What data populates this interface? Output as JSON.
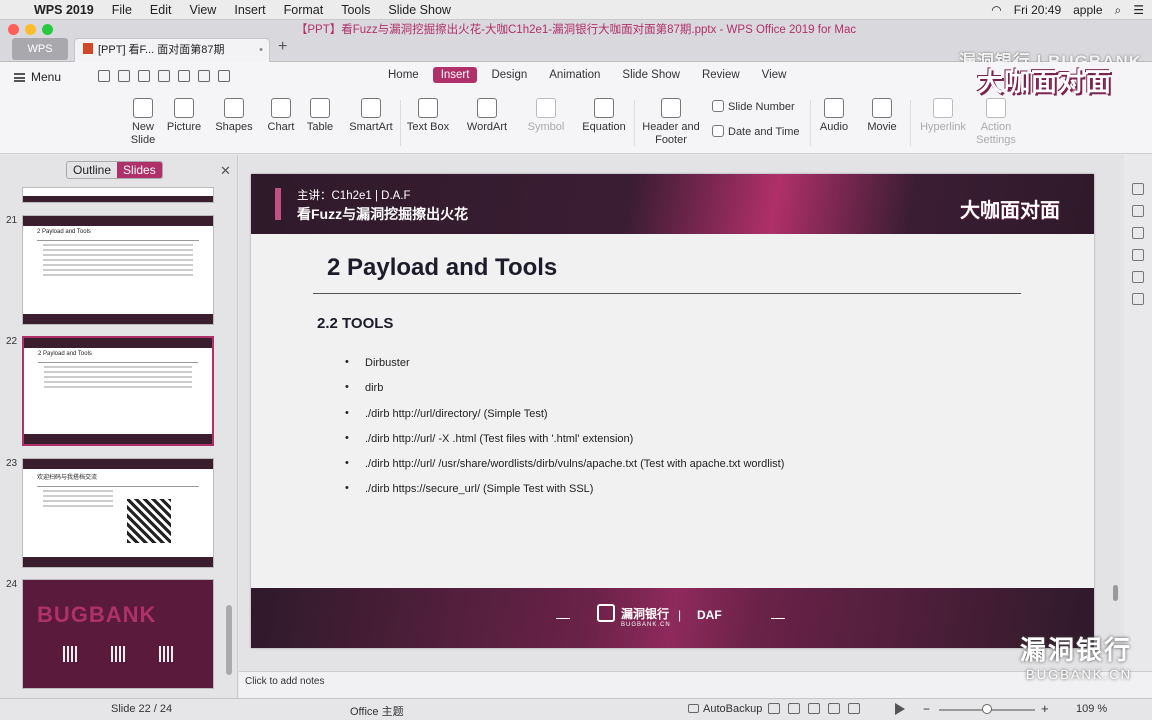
{
  "menubar": {
    "app": "WPS 2019",
    "items": [
      "File",
      "Edit",
      "View",
      "Insert",
      "Format",
      "Tools",
      "Slide Show"
    ],
    "clock": "Fri 20:49",
    "user": "apple"
  },
  "window": {
    "title": "【PPT】看Fuzz与漏洞挖掘擦出火花-大咖C1h2e1-漏洞银行大咖面对面第87期.pptx - WPS Office 2019 for Mac",
    "wps_tab": "WPS",
    "doc_tab": "[PPT] 看F... 面对面第87期",
    "watermark": "漏洞银行 | BUGBANK"
  },
  "ribbon": {
    "menu_label": "Menu",
    "tabs": [
      "Home",
      "Insert",
      "Design",
      "Animation",
      "Slide Show",
      "Review",
      "View"
    ],
    "active_tab": "Insert",
    "logo": "大咖面对面",
    "tools": {
      "new_slide": "New Slide",
      "picture": "Picture",
      "shapes": "Shapes",
      "chart": "Chart",
      "table": "Table",
      "smartart": "SmartArt",
      "text_box": "Text Box",
      "wordart": "WordArt",
      "symbol": "Symbol",
      "equation": "Equation",
      "header_footer": "Header and Footer",
      "slide_number": "Slide Number",
      "date_time": "Date and Time",
      "audio": "Audio",
      "movie": "Movie",
      "hyperlink": "Hyperlink",
      "action_settings": "Action Settings"
    }
  },
  "left_pane": {
    "outline_label": "Outline",
    "slides_label": "Slides",
    "thumbs": [
      {
        "num": "21",
        "title": "2 Payload and Tools"
      },
      {
        "num": "22",
        "title": "2 Payload and Tools"
      },
      {
        "num": "23",
        "title": "欢迎扫码与我搭档交流"
      },
      {
        "num": "24",
        "title": "BUGBANK"
      }
    ]
  },
  "slide": {
    "speaker": "主讲：C1h2e1 | D.A.F",
    "header_title": "看Fuzz与漏洞挖掘擦出火花",
    "logo": "大咖面对面",
    "title": "2 Payload and Tools",
    "subtitle": "2.2 TOOLS",
    "bullets": [
      "Dirbuster",
      "dirb",
      "./dirb http://url/directory/ (Simple Test)",
      "./dirb http://url/ -X .html (Test files with '.html' extension)",
      "./dirb http://url/ /usr/share/wordlists/dirb/vulns/apache.txt (Test with apache.txt wordlist)",
      "./dirb https://secure_url/ (Simple Test with SSL)"
    ],
    "footer_brand": "漏洞银行",
    "footer_brand_sub": "BUGBANK.CN",
    "footer_pipe": "|",
    "footer_daf": "DAF"
  },
  "notes": {
    "placeholder": "Click to add notes"
  },
  "status": {
    "slide_counter": "Slide 22 / 24",
    "theme": "Office 主题",
    "autobackup": "AutoBackup",
    "zoom": "109 %",
    "zoom_level": 0.5
  },
  "watermark_br": {
    "cn": "漏洞银行",
    "en": "BUGBANK.CN"
  }
}
